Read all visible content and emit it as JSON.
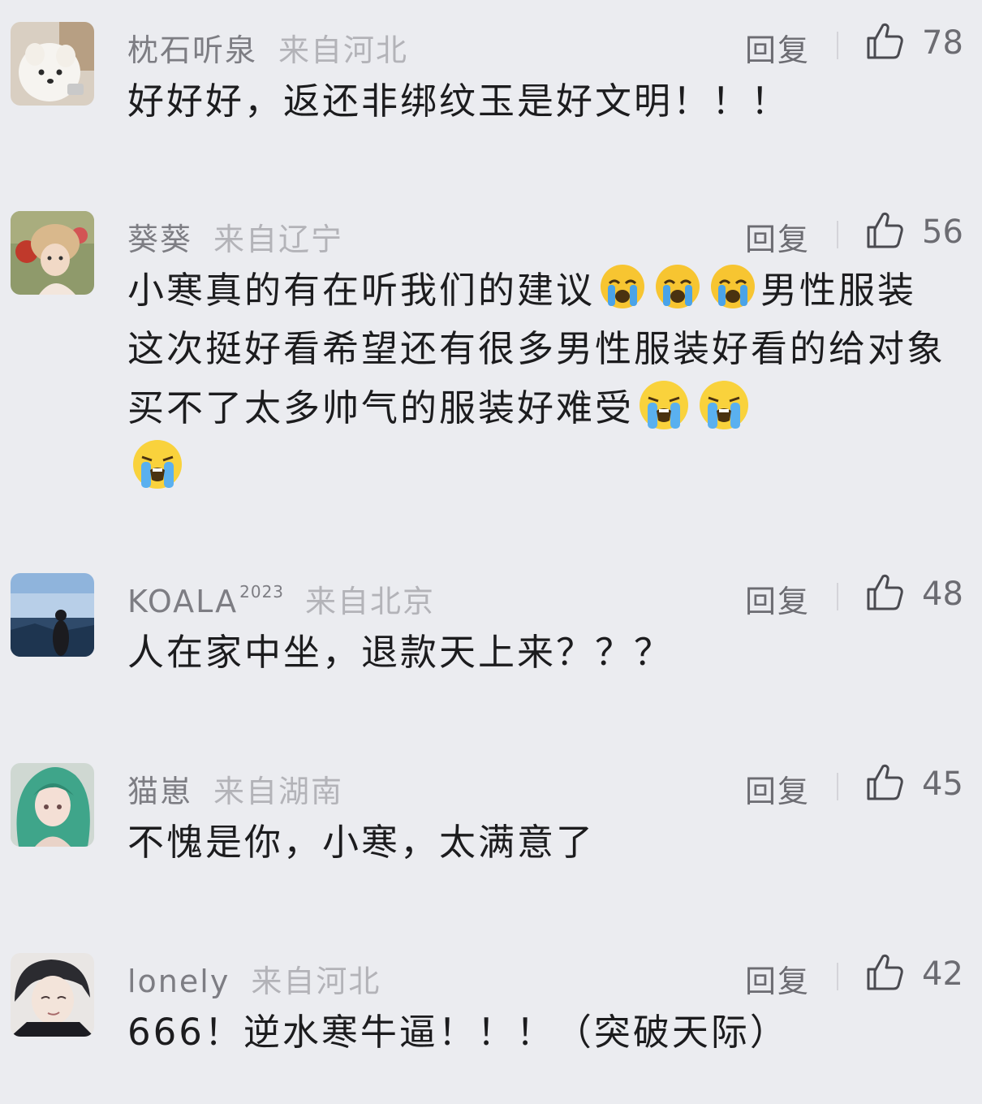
{
  "comments": [
    {
      "username": "枕石听泉",
      "location": "来自河北",
      "reply": "回复",
      "likes": "78",
      "text": "好好好，返还非绑纹玉是好文明！！！",
      "avatar": "white-dog-avatar"
    },
    {
      "username": "葵葵",
      "location": "来自辽宁",
      "reply": "回复",
      "likes": "56",
      "text_parts": [
        "小寒真的有在听我们的建议",
        "男性服装这次挺好看希望还有很多男性服装好看的给对象买不了太多帅气的服装好难受"
      ],
      "emoji_1": "crying-face-emoji",
      "emoji_2": "loudly-crying-face-emoji",
      "avatar": "girl-with-hat-avatar"
    },
    {
      "username": "KOALA",
      "username_sup": "2023",
      "location": "来自北京",
      "reply": "回复",
      "likes": "48",
      "text": "人在家中坐，退款天上来？？？",
      "avatar": "seaside-person-avatar"
    },
    {
      "username": "猫崽",
      "location": "来自湖南",
      "reply": "回复",
      "likes": "45",
      "text": "不愧是你，小寒，太满意了",
      "avatar": "green-hair-girl-avatar"
    },
    {
      "username": "lonely",
      "location": "来自河北",
      "reply": "回复",
      "likes": "42",
      "text": "666！逆水寒牛逼！！！（突破天际）",
      "avatar": "anime-boy-avatar"
    }
  ],
  "colors": {
    "background": "#ebecf0",
    "username": "#7d7d83",
    "location": "#b3b3b8",
    "text": "#1c1c1e"
  }
}
